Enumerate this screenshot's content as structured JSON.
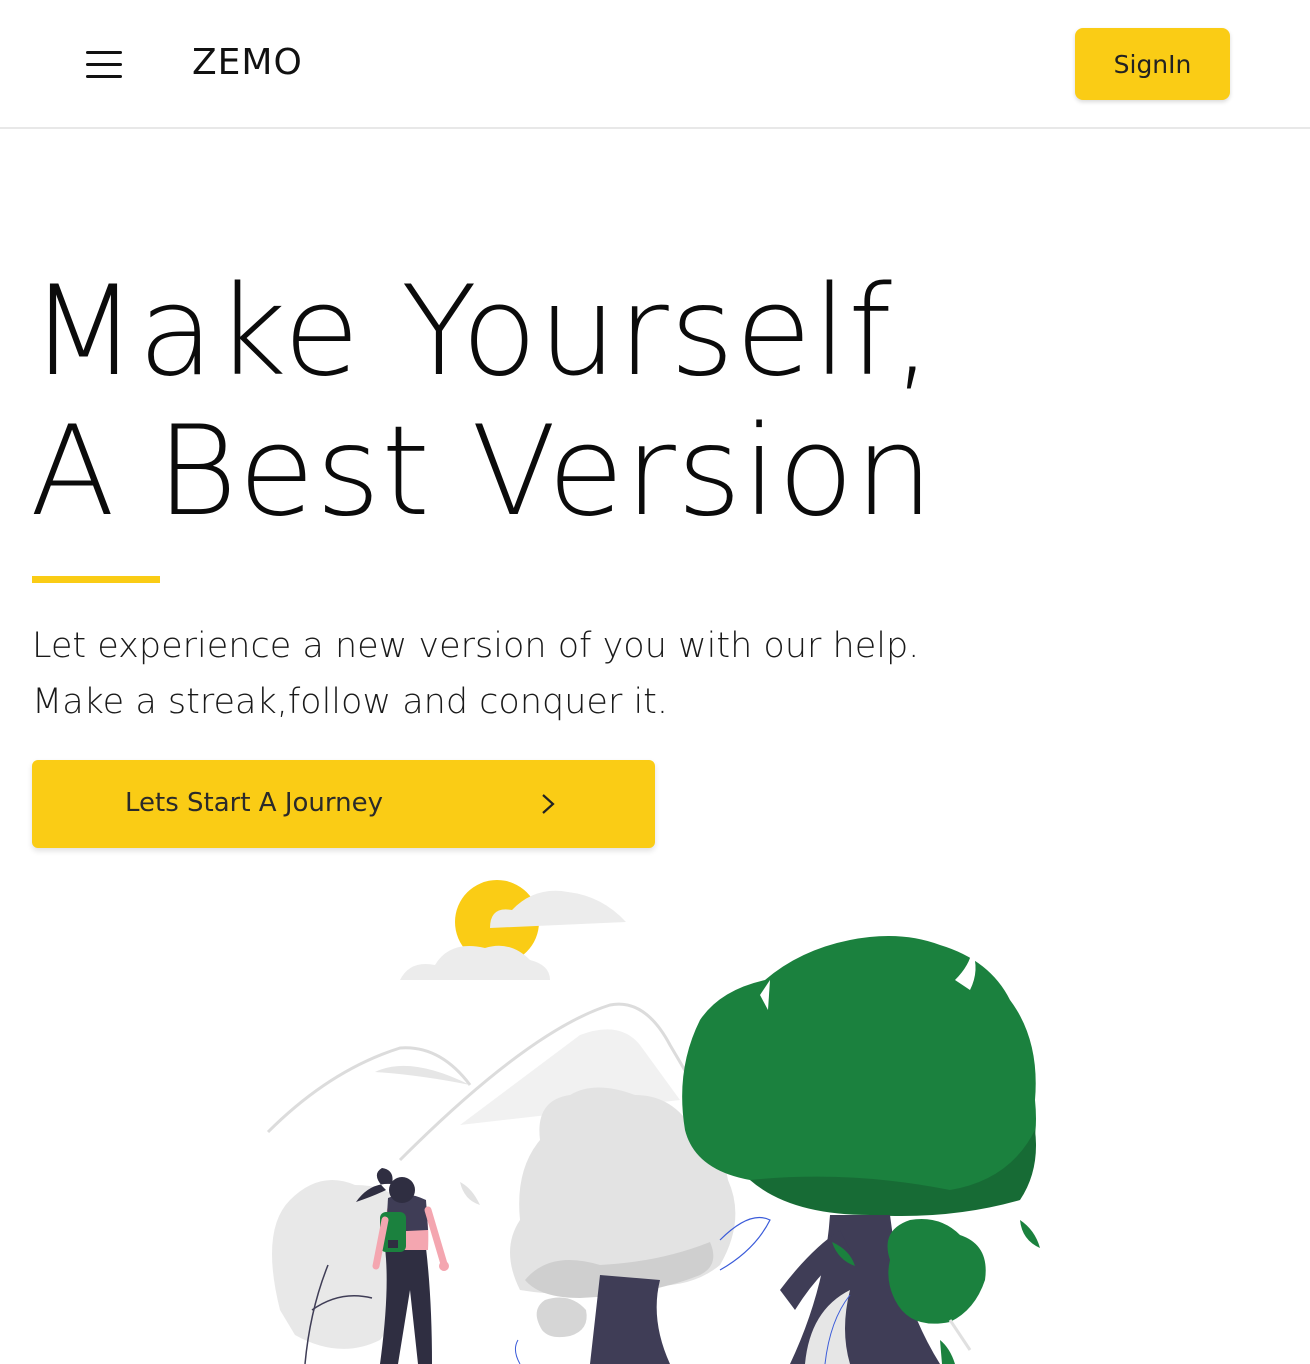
{
  "navbar": {
    "menu_icon": "hamburger-menu-icon",
    "brand": "ZEMO",
    "signin_label": "SignIn"
  },
  "hero": {
    "title_line1": "Make Yourself,",
    "title_line2": "A Best Version",
    "subtitle_line1": "Let experience a new version of you with our help.",
    "subtitle_line2": "Make a streak,follow and conquer it.",
    "cta_label": "Lets Start A Journey",
    "cta_icon": "chevron-right-icon"
  },
  "colors": {
    "accent": "#facc15",
    "tree_green": "#1b813e",
    "trunk": "#3f3d56"
  }
}
